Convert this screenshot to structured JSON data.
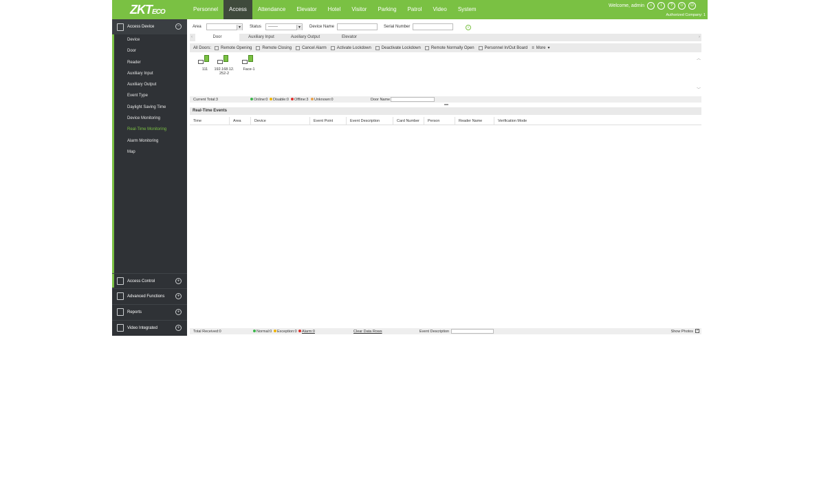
{
  "header": {
    "logo_main": "ZKT",
    "logo_small": "ECO",
    "nav": [
      "Personnel",
      "Access",
      "Attendance",
      "Elevator",
      "Hotel",
      "Visitor",
      "Parking",
      "Patrol",
      "Video",
      "System"
    ],
    "active_nav": "Access",
    "welcome": "Welcome, admin",
    "company": "Authorized Company: 1",
    "accent_color": "#7ac143"
  },
  "sidebar": {
    "section_title": "Access Device",
    "items": [
      "Device",
      "Door",
      "Reader",
      "Auxiliary Input",
      "Auxiliary Output",
      "Event Type",
      "Daylight Saving Time",
      "Device Monitoring",
      "Real-Time Monitoring",
      "Alarm Monitoring",
      "Map"
    ],
    "active_item": "Real-Time Monitoring",
    "lower_sections": [
      "Access Control",
      "Advanced Functions",
      "Reports",
      "Video Integrated"
    ]
  },
  "filters": {
    "area_label": "Area",
    "area_value": "",
    "status_label": "Status",
    "status_value": "-------",
    "device_name_label": "Device Name",
    "device_name_value": "",
    "serial_label": "Serial Number",
    "serial_value": ""
  },
  "tabs": [
    "Door",
    "Auxiliary Input",
    "Auxiliary Output",
    "Elevator"
  ],
  "toolbar": {
    "all_doors": "All Doors:",
    "actions": [
      "Remote Opening",
      "Remote Closing",
      "Cancel Alarm",
      "Activate Lockdown",
      "Deactivate Lockdown",
      "Remote Normally Open",
      "Personnel In/Out Board",
      "More"
    ]
  },
  "doors": [
    {
      "name": "111"
    },
    {
      "name": "192.168.12.252-2"
    },
    {
      "name": "Face-1"
    }
  ],
  "door_status": {
    "current_total": "Current Total:3",
    "online": "Online:0",
    "disable": "Disable:0",
    "offline": "Offline:3",
    "unknown": "Unknown:0",
    "door_name_label": "Door Name"
  },
  "events": {
    "title": "Real-Time Events",
    "columns": [
      "Time",
      "Area",
      "Device",
      "Event Point",
      "Event Description",
      "Card Number",
      "Person",
      "Reader Name",
      "Verification Mode"
    ],
    "rows": []
  },
  "footer": {
    "total_received": "Total Received:0",
    "normal": "Normal:0",
    "exception": "Exception:0",
    "alarm": "Alarm:0",
    "clear_rows": "Clear Data Rows",
    "event_desc_label": "Event Description",
    "show_photos": "Show Photos"
  }
}
